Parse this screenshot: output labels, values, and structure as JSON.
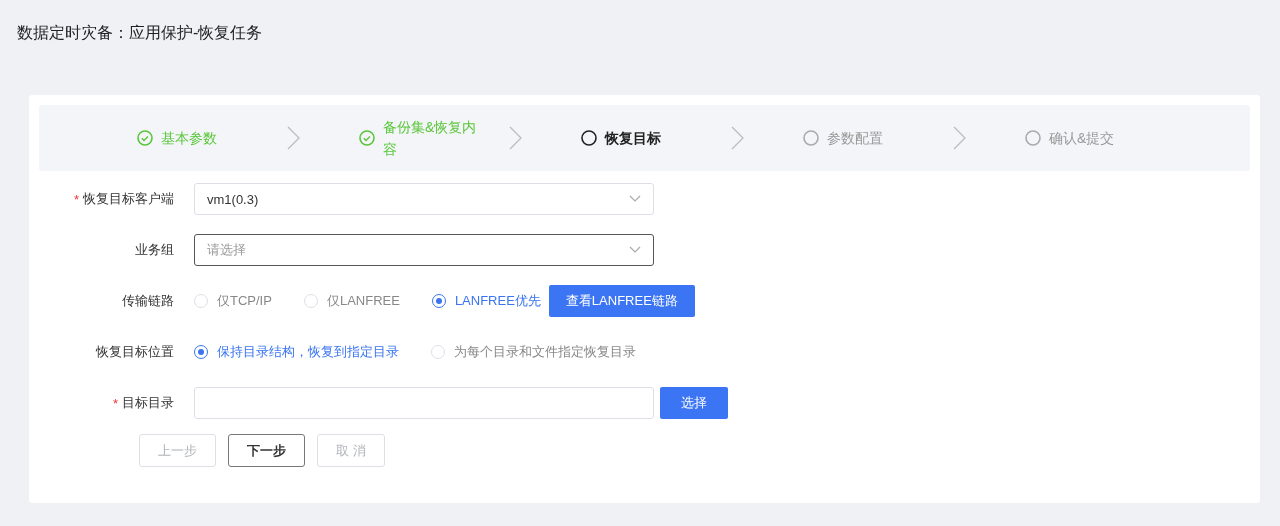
{
  "page_title": "数据定时灾备：应用保护-恢复任务",
  "steps": [
    {
      "label": "基本参数",
      "completed": true,
      "current": false
    },
    {
      "label": "备份集&恢复内容",
      "completed": true,
      "current": false
    },
    {
      "label": "恢复目标",
      "completed": false,
      "current": true
    },
    {
      "label": "参数配置",
      "completed": false,
      "current": false
    },
    {
      "label": "确认&提交",
      "completed": false,
      "current": false
    }
  ],
  "form": [
    {
      "kind": "select",
      "required_mark": "*",
      "label": "恢复目标客户端",
      "value": "vm1(0.3)"
    },
    {
      "kind": "select",
      "label": "业务组",
      "placeholder": "请选择",
      "focused": true
    },
    {
      "kind": "radio",
      "label": "传输链路",
      "options": [
        {
          "label": "仅TCP/IP",
          "selected": false
        },
        {
          "label": "仅LANFREE",
          "selected": false
        },
        {
          "label": "LANFREE优先",
          "selected": true
        }
      ],
      "button": "查看LANFREE链路"
    },
    {
      "kind": "radio",
      "label": "恢复目标位置",
      "options": [
        {
          "label": "保持目录结构，恢复到指定目录",
          "selected": true
        },
        {
          "label": "为每个目录和文件指定恢复目录",
          "selected": false
        }
      ]
    },
    {
      "kind": "input",
      "required_mark": "*",
      "label": "目标目录",
      "button": "选择"
    }
  ],
  "actions": [
    {
      "label": "上一步",
      "disabled": true
    },
    {
      "label": "下一步",
      "disabled": false
    },
    {
      "label": "取 消",
      "disabled": true
    }
  ]
}
